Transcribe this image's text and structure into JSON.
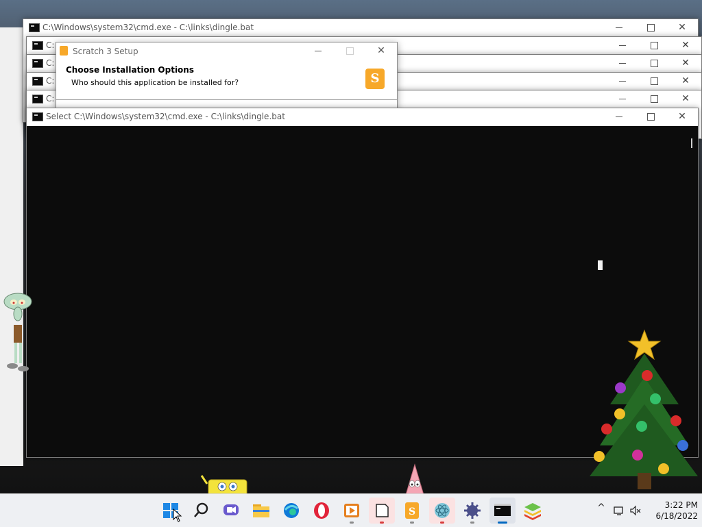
{
  "cmd_windows": [
    {
      "title": "C:\\Windows\\system32\\cmd.exe - C:\\links\\dingle.bat"
    },
    {
      "title": "C:"
    },
    {
      "title": "C:"
    },
    {
      "title": "C:"
    },
    {
      "title": "C:"
    }
  ],
  "active_cmd": {
    "title": "Select C:\\Windows\\system32\\cmd.exe - C:\\links\\dingle.bat"
  },
  "setup_dialog": {
    "title": "Scratch 3 Setup",
    "heading": "Choose Installation Options",
    "subheading": "Who should this application be installed for?",
    "logo_glyph": "S"
  },
  "window_controls": {
    "minimize": "—",
    "maximize": "□",
    "close": "✕"
  },
  "taskbar": {
    "items": [
      {
        "name": "start-button",
        "icon": "windows-logo-icon"
      },
      {
        "name": "search-button",
        "icon": "search-icon"
      },
      {
        "name": "teams-chat-button",
        "icon": "teams-chat-icon"
      },
      {
        "name": "file-explorer-button",
        "icon": "folder-icon"
      },
      {
        "name": "edge-button",
        "icon": "edge-icon"
      },
      {
        "name": "opera-button",
        "icon": "opera-icon"
      },
      {
        "name": "media-player-button",
        "icon": "media-player-icon"
      },
      {
        "name": "document-app-button",
        "icon": "document-icon"
      },
      {
        "name": "scratch-button",
        "icon": "scratch-icon"
      },
      {
        "name": "electron-app-button",
        "icon": "atom-icon"
      },
      {
        "name": "gear-app-button",
        "icon": "spiky-gear-icon"
      },
      {
        "name": "terminal-button",
        "icon": "terminal-icon"
      },
      {
        "name": "bluestacks-button",
        "icon": "stacked-layers-icon"
      }
    ],
    "tray": {
      "chevron": "^",
      "clock_time": "3:22 PM",
      "clock_date": "6/18/2022"
    }
  },
  "colors": {
    "console_bg": "#0c0c0c",
    "scratch_orange": "#f7a829",
    "accent": "#0067c0"
  }
}
